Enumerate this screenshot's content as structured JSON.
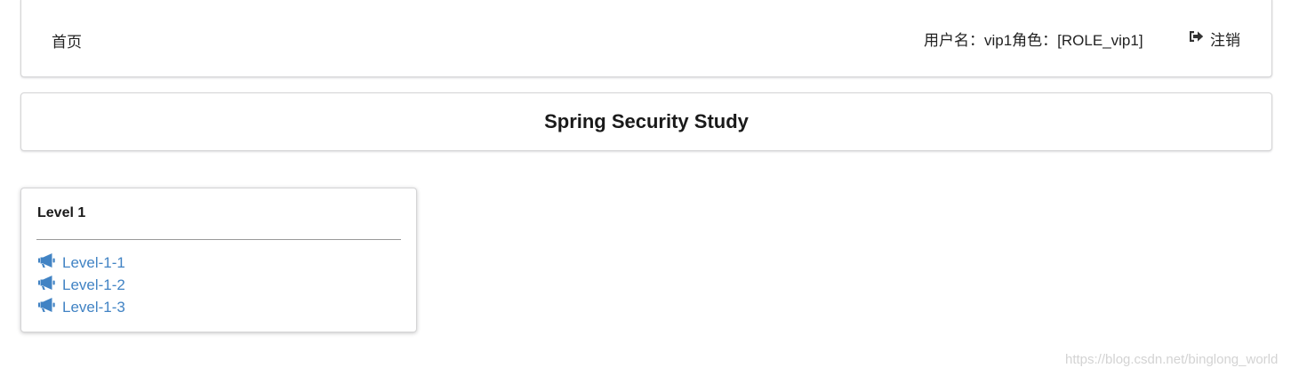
{
  "navbar": {
    "home_label": "首页",
    "user_info": "用户名：vip1角色：[ROLE_vip1]",
    "logout_label": "注销",
    "logout_icon": "sign-out-icon"
  },
  "title": {
    "text": "Spring Security Study"
  },
  "card": {
    "header": "Level 1",
    "link_icon": "bullhorn-icon",
    "links": [
      {
        "label": "Level-1-1"
      },
      {
        "label": "Level-1-2"
      },
      {
        "label": "Level-1-3"
      }
    ]
  },
  "watermark": {
    "text": "https://blog.csdn.net/binglong_world"
  },
  "colors": {
    "link": "#4183c4",
    "border": "#d4d4d5",
    "text": "#1f1f1f",
    "watermark": "#d3d3d3"
  }
}
